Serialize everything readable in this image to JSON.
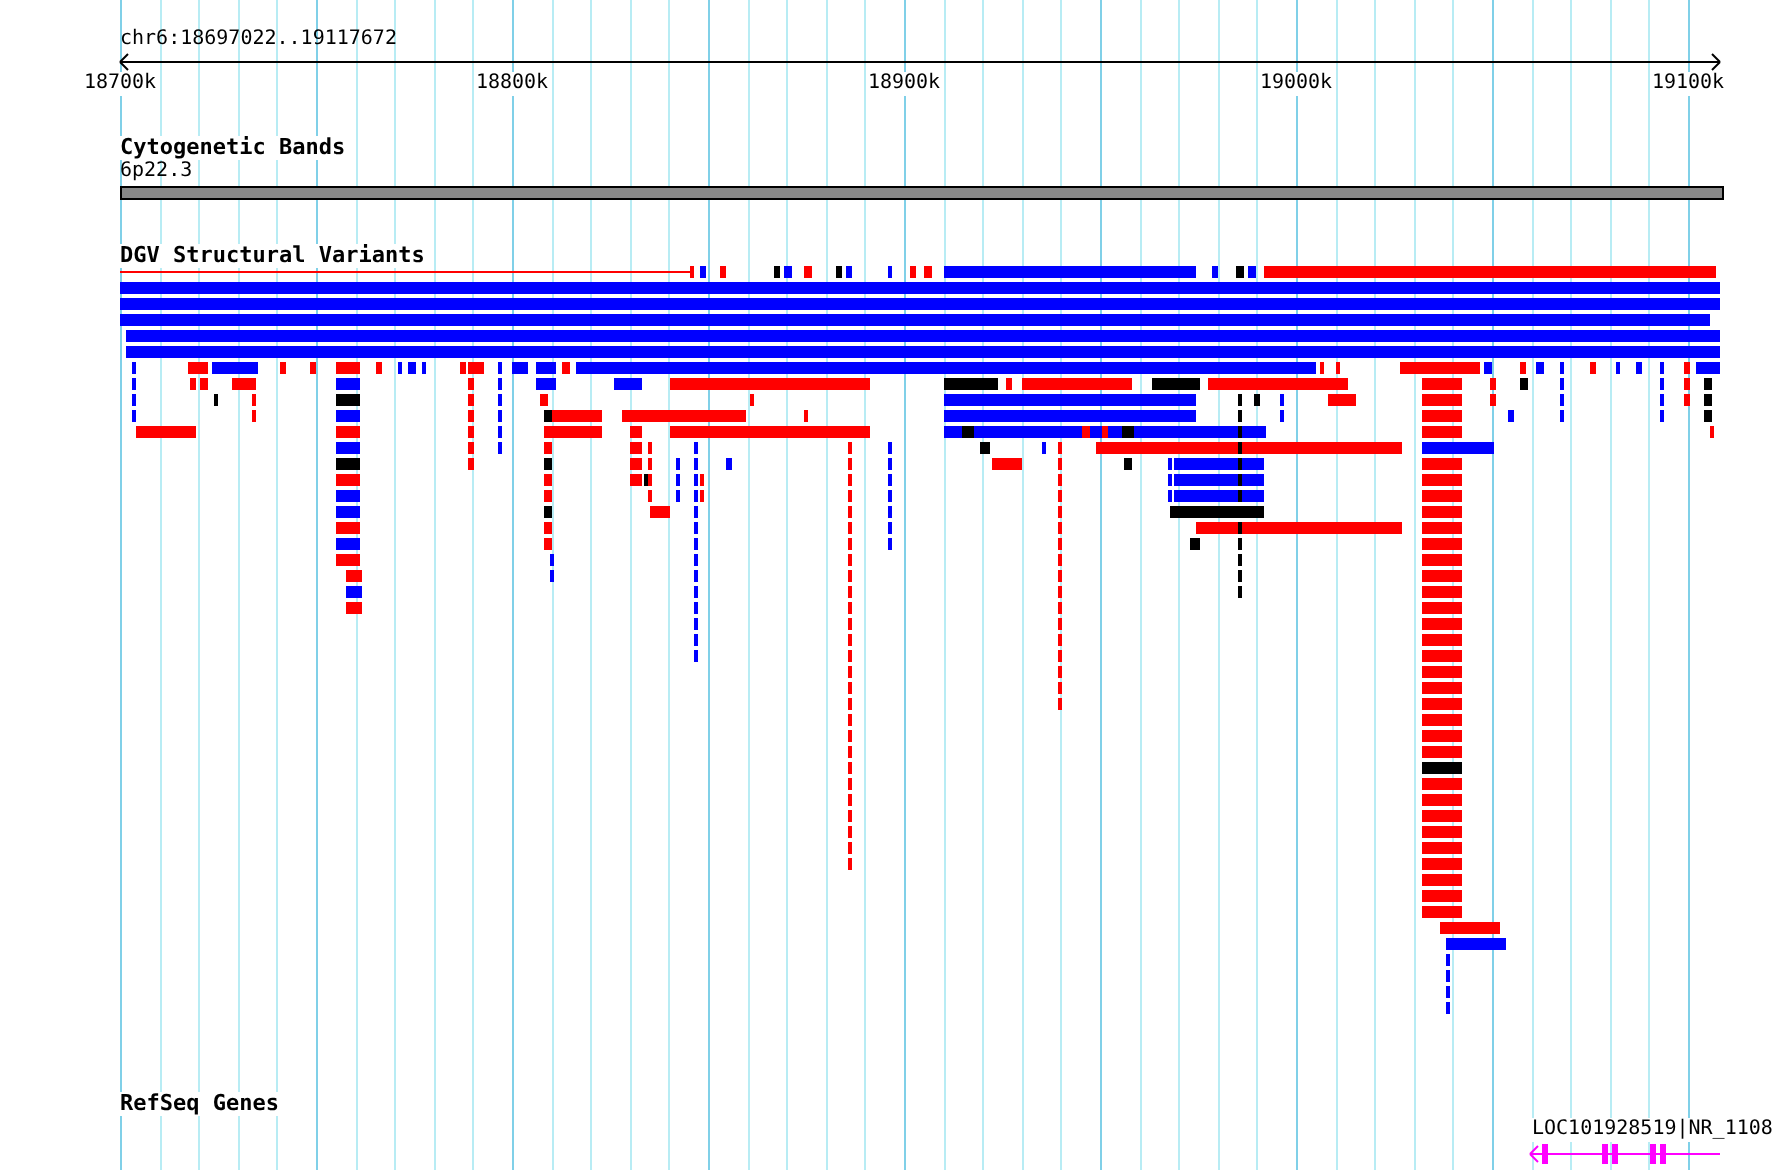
{
  "ruler": {
    "range": "chr6:18697022..19117672",
    "ticks": [
      "18700k",
      "18800k",
      "18900k",
      "19000k",
      "19100k"
    ]
  },
  "tracks": [
    {
      "kind": "cytoband",
      "title": "Cytogenetic Bands",
      "band": "6p22.3"
    },
    {
      "kind": "variants",
      "title": "DGV Structural Variants"
    },
    {
      "kind": "genes",
      "title": "RefSeq Genes",
      "gene": "LOC101928519|NR_1108"
    }
  ]
}
